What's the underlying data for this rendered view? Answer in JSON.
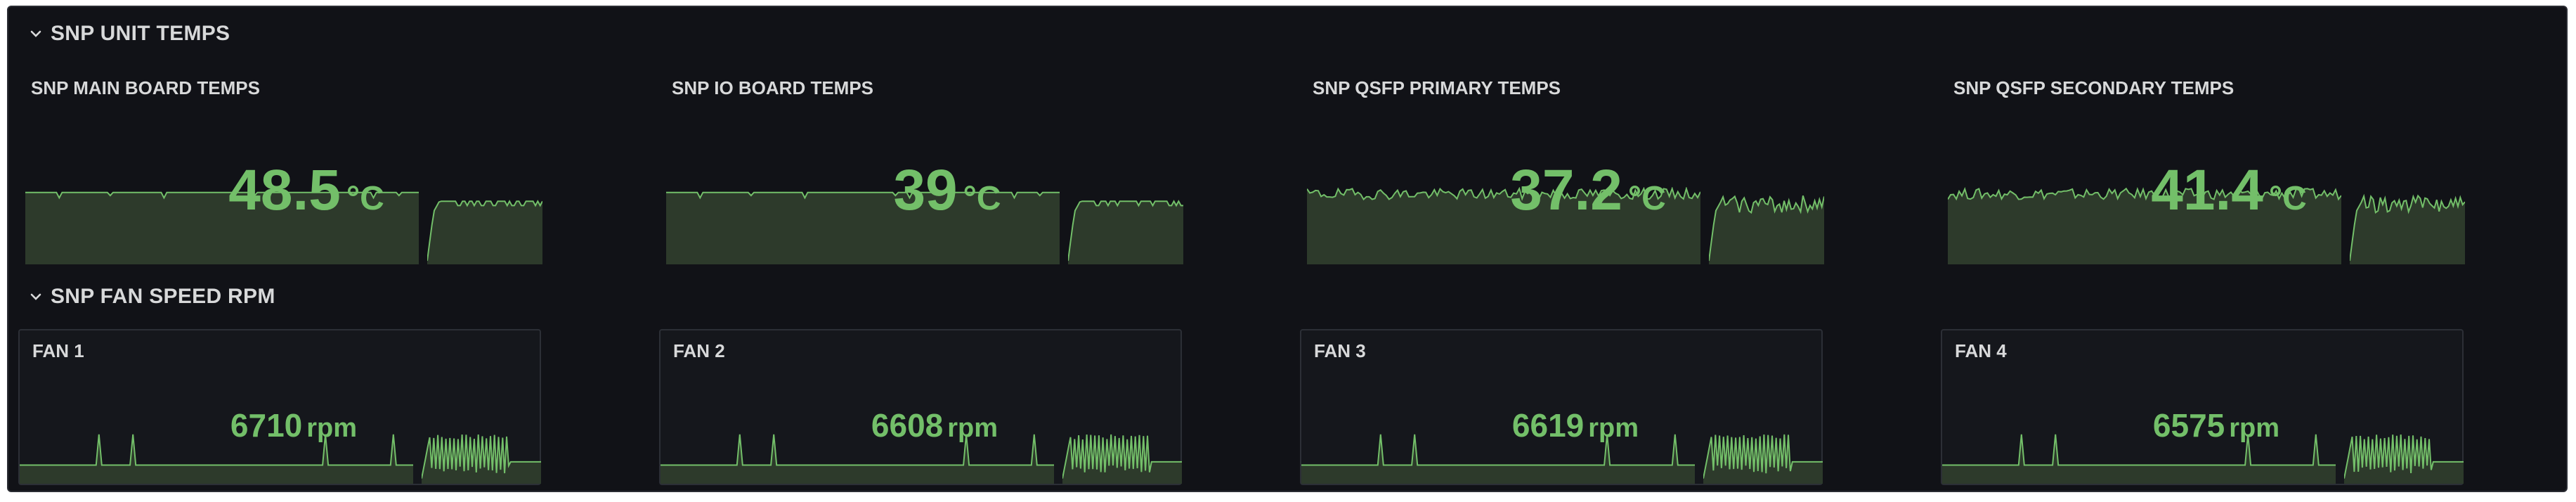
{
  "sections": {
    "temps_title": "SNP UNIT TEMPS",
    "fans_title": "SNP FAN SPEED RPM"
  },
  "temps": [
    {
      "title": "SNP MAIN BOARD TEMPS",
      "value": "48.5",
      "unit": "°C"
    },
    {
      "title": "SNP IO BOARD TEMPS",
      "value": "39",
      "unit": "°C"
    },
    {
      "title": "SNP QSFP PRIMARY TEMPS",
      "value": "37.2",
      "unit": "°C"
    },
    {
      "title": "SNP QSFP SECONDARY TEMPS",
      "value": "41.4",
      "unit": "°C"
    }
  ],
  "fans": [
    {
      "title": "FAN 1",
      "value": "6710",
      "unit": "rpm"
    },
    {
      "title": "FAN 2",
      "value": "6608",
      "unit": "rpm"
    },
    {
      "title": "FAN 3",
      "value": "6619",
      "unit": "rpm"
    },
    {
      "title": "FAN 4",
      "value": "6575",
      "unit": "rpm"
    }
  ],
  "colors": {
    "value": "#73bf69",
    "spark_fill": "#2d3a2b",
    "spark_line": "#73bf69",
    "background": "#111217",
    "text": "#d8d9da"
  }
}
